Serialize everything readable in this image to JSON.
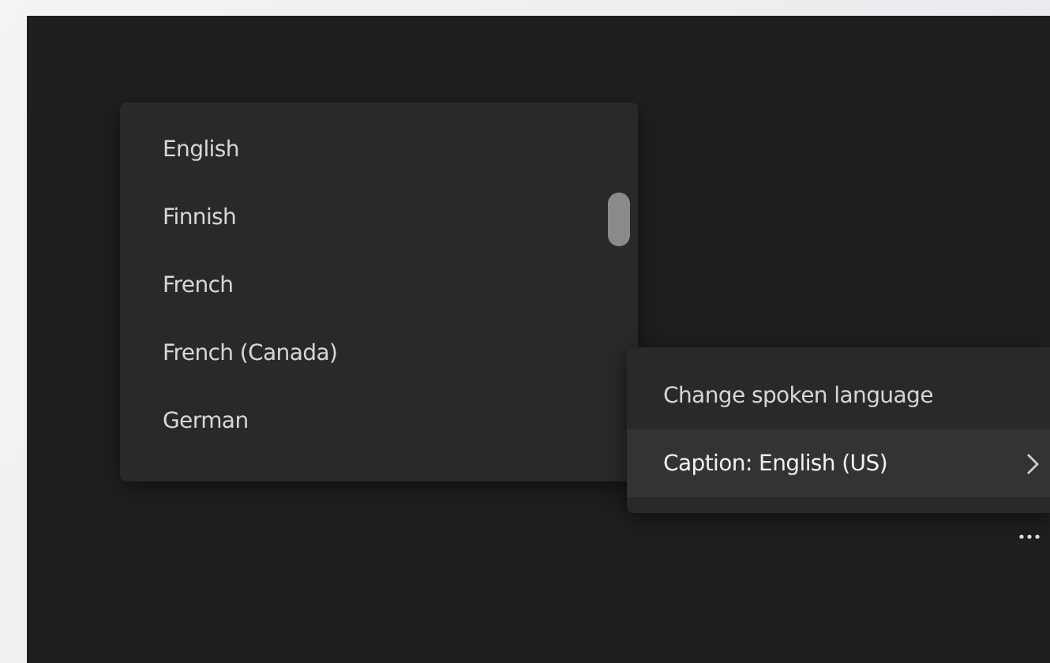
{
  "language_menu": {
    "items": [
      {
        "label": "English",
        "selected": false
      },
      {
        "label": "Finnish",
        "selected": false
      },
      {
        "label": "French",
        "selected": false
      },
      {
        "label": "French (Canada)",
        "selected": false
      },
      {
        "label": "German",
        "selected": false
      }
    ]
  },
  "context_menu": {
    "items": [
      {
        "label": "Change spoken language",
        "selected": false,
        "submenu": false
      },
      {
        "label": "Caption: English (US)",
        "selected": true,
        "submenu": true
      }
    ]
  }
}
